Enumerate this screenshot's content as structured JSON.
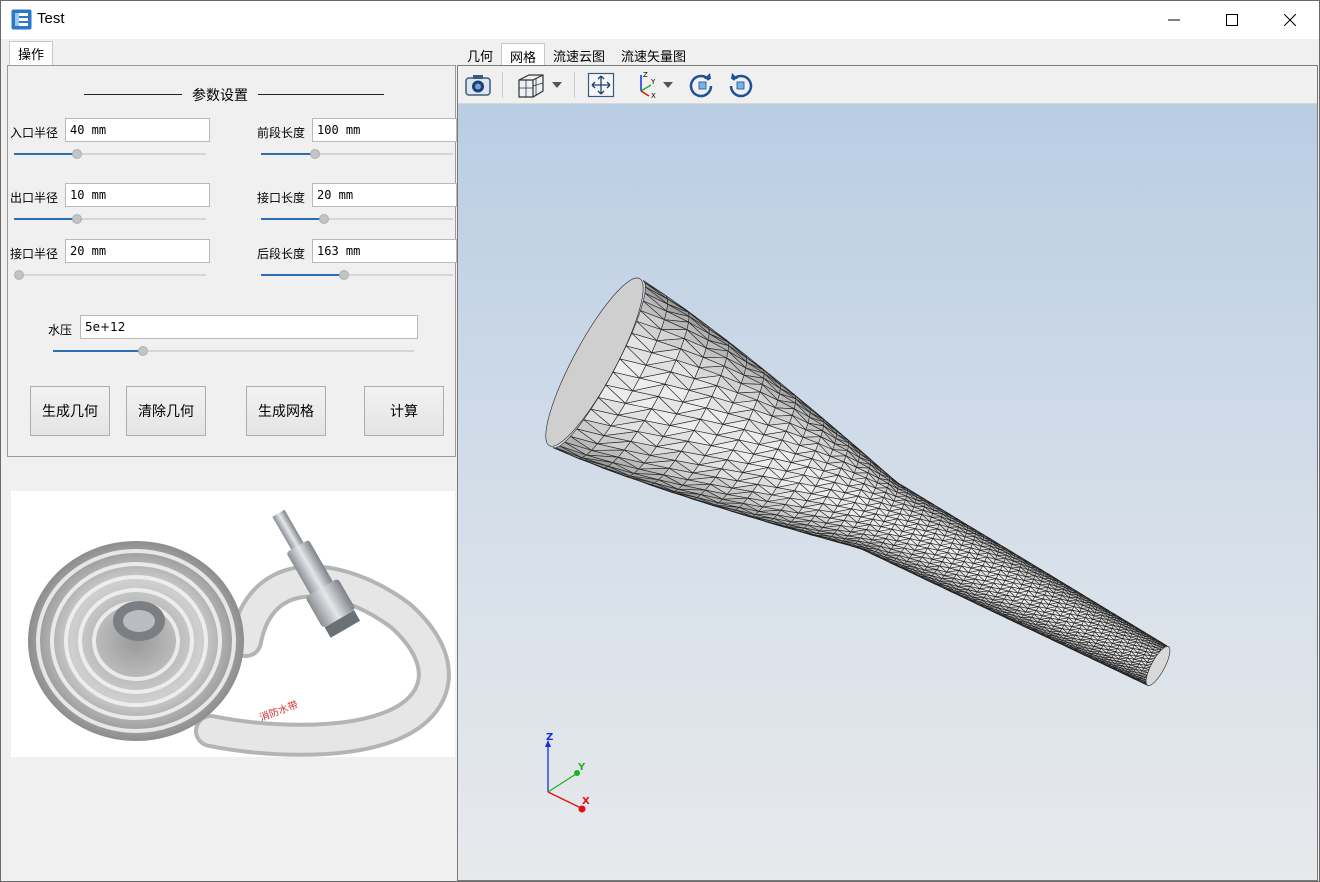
{
  "window": {
    "title": "Test"
  },
  "left_tab": "操作",
  "params": {
    "section_title": "参数设置",
    "inlet_radius": {
      "label": "入口半径",
      "value": "40 mm",
      "level": 0.33
    },
    "outlet_radius": {
      "label": "出口半径",
      "value": "10 mm",
      "level": 0.33
    },
    "joint_radius": {
      "label": "接口半径",
      "value": "20 mm",
      "level": 0.0
    },
    "front_length": {
      "label": "前段长度",
      "value": "100 mm",
      "level": 0.28
    },
    "joint_length": {
      "label": "接口长度",
      "value": "20 mm",
      "level": 0.33
    },
    "rear_length": {
      "label": "后段长度",
      "value": "163 mm",
      "level": 0.43
    },
    "water_pressure": {
      "label": "水压",
      "value": "5e+12",
      "level": 0.25
    }
  },
  "buttons": {
    "gen_geometry": "生成几何",
    "clear_geometry": "清除几何",
    "gen_mesh": "生成网格",
    "compute": "计算"
  },
  "view_tabs": [
    {
      "label": "几何",
      "active": false
    },
    {
      "label": "网格",
      "active": true
    },
    {
      "label": "流速云图",
      "active": false
    },
    {
      "label": "流速矢量图",
      "active": false
    }
  ],
  "toolbar_icons": [
    "camera-icon",
    "cube-view-icon",
    "fit-view-icon",
    "axes-orientation-icon",
    "rotate-cw-icon",
    "rotate-ccw-icon"
  ],
  "axis_triad": {
    "z": "Z",
    "y": "Y",
    "x": "X"
  },
  "colors": {
    "accent": "#2a6fb4",
    "axis_x": "#e01010",
    "axis_y": "#20b020",
    "axis_z": "#1030e0"
  }
}
